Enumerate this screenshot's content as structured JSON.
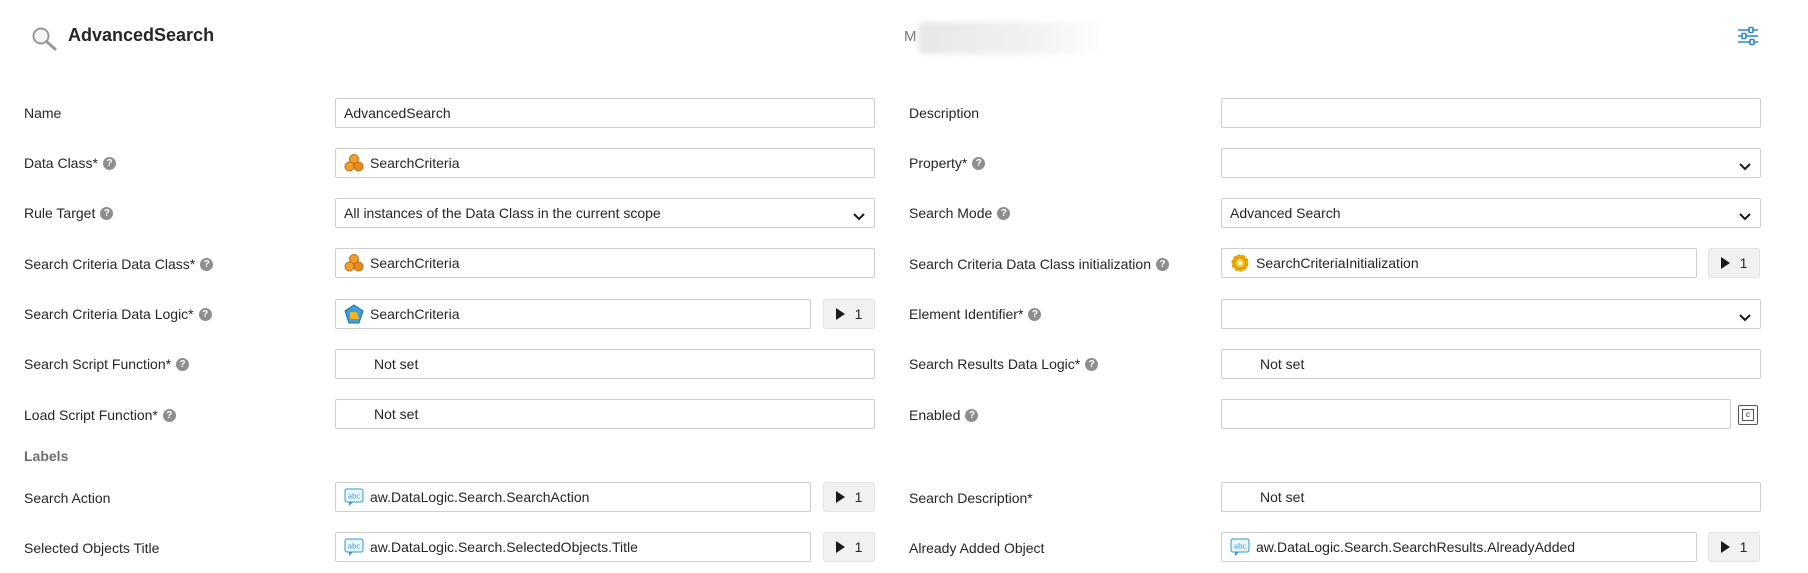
{
  "header": {
    "title": "AdvancedSearch",
    "user_initial": "M"
  },
  "form": {
    "name": {
      "label": "Name",
      "value": "AdvancedSearch"
    },
    "description": {
      "label": "Description",
      "value": ""
    },
    "data_class": {
      "label": "Data Class*",
      "value": "SearchCriteria",
      "icon": "data-class-icon"
    },
    "property": {
      "label": "Property*",
      "value": ""
    },
    "rule_target": {
      "label": "Rule Target",
      "value": "All instances of the Data Class in the current scope"
    },
    "search_mode": {
      "label": "Search Mode",
      "value": "Advanced Search"
    },
    "search_criteria_data_class": {
      "label": "Search Criteria Data Class*",
      "value": "SearchCriteria",
      "icon": "data-class-icon"
    },
    "search_criteria_init": {
      "label": "Search Criteria Data Class initialization",
      "value": "SearchCriteriaInitialization",
      "icon": "gear-icon",
      "count": "1"
    },
    "search_criteria_data_logic": {
      "label": "Search Criteria Data Logic*",
      "value": "SearchCriteria",
      "icon": "data-logic-icon",
      "count": "1"
    },
    "element_identifier": {
      "label": "Element Identifier*",
      "value": ""
    },
    "search_script_function": {
      "label": "Search Script Function*",
      "value": "Not set"
    },
    "search_results_data_logic": {
      "label": "Search Results Data Logic*",
      "value": "Not set"
    },
    "load_script_function": {
      "label": "Load Script Function*",
      "value": "Not set"
    },
    "enabled": {
      "label": "Enabled",
      "value": ""
    }
  },
  "labels_section": {
    "title": "Labels",
    "search_action": {
      "label": "Search Action",
      "value": "aw.DataLogic.Search.SearchAction",
      "icon": "text-label-icon",
      "count": "1"
    },
    "search_description": {
      "label": "Search Description*",
      "value": "Not set"
    },
    "selected_objects_title": {
      "label": "Selected Objects Title",
      "value": "aw.DataLogic.Search.SelectedObjects.Title",
      "icon": "text-label-icon",
      "count": "1"
    },
    "already_added_object": {
      "label": "Already Added Object",
      "value": "aw.DataLogic.Search.SearchResults.AlreadyAdded",
      "icon": "text-label-icon",
      "count": "1"
    }
  }
}
